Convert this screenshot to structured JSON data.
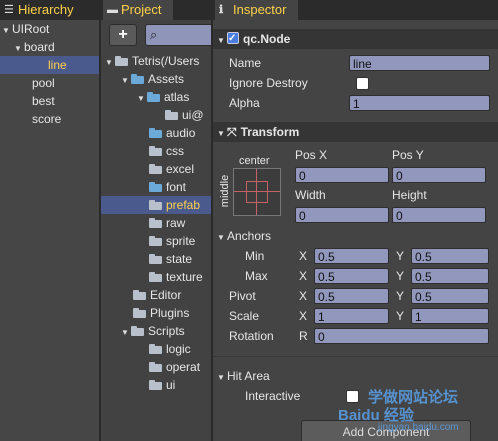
{
  "hierarchy": {
    "tab": "Hierarchy",
    "items": [
      {
        "label": "UIRoot"
      },
      {
        "label": "board"
      },
      {
        "label": "line"
      },
      {
        "label": "pool"
      },
      {
        "label": "best"
      },
      {
        "label": "score"
      }
    ]
  },
  "project": {
    "tab": "Project",
    "add_label": "+",
    "items": [
      {
        "label": "Tetris(/Users"
      },
      {
        "label": "Assets"
      },
      {
        "label": "atlas"
      },
      {
        "label": "ui@"
      },
      {
        "label": "audio"
      },
      {
        "label": "css"
      },
      {
        "label": "excel"
      },
      {
        "label": "font"
      },
      {
        "label": "prefab"
      },
      {
        "label": "raw"
      },
      {
        "label": "sprite"
      },
      {
        "label": "state"
      },
      {
        "label": "texture"
      },
      {
        "label": "Editor"
      },
      {
        "label": "Plugins"
      },
      {
        "label": "Scripts"
      },
      {
        "label": "logic"
      },
      {
        "label": "operat"
      },
      {
        "label": "ui"
      }
    ]
  },
  "inspector": {
    "tab": "Inspector",
    "node": {
      "title": "qc.Node",
      "name_label": "Name",
      "name_value": "line",
      "ignore_destroy_label": "Ignore Destroy",
      "alpha_label": "Alpha",
      "alpha_value": "1"
    },
    "transform": {
      "title": "Transform",
      "center_label": "center",
      "middle_label": "middle",
      "posx_label": "Pos X",
      "posx_value": "0",
      "posy_label": "Pos Y",
      "posy_value": "0",
      "width_label": "Width",
      "width_value": "0",
      "height_label": "Height",
      "height_value": "0",
      "anchors_label": "Anchors",
      "min_label": "Min",
      "min_x": "0.5",
      "min_y": "0.5",
      "max_label": "Max",
      "max_x": "0.5",
      "max_y": "0.5",
      "pivot_label": "Pivot",
      "pivot_x": "0.5",
      "pivot_y": "0.5",
      "scale_label": "Scale",
      "scale_x": "1",
      "scale_y": "1",
      "rotation_label": "Rotation",
      "rotation_value": "0",
      "x": "X",
      "y": "Y",
      "r": "R"
    },
    "hitarea": {
      "title": "Hit Area",
      "interactive_label": "Interactive"
    },
    "add_component": "Add Component"
  },
  "watermark": {
    "line1": "学做网站论坛",
    "line2": "Baidu 经验",
    "line3": "jingyan.baidu.com"
  }
}
